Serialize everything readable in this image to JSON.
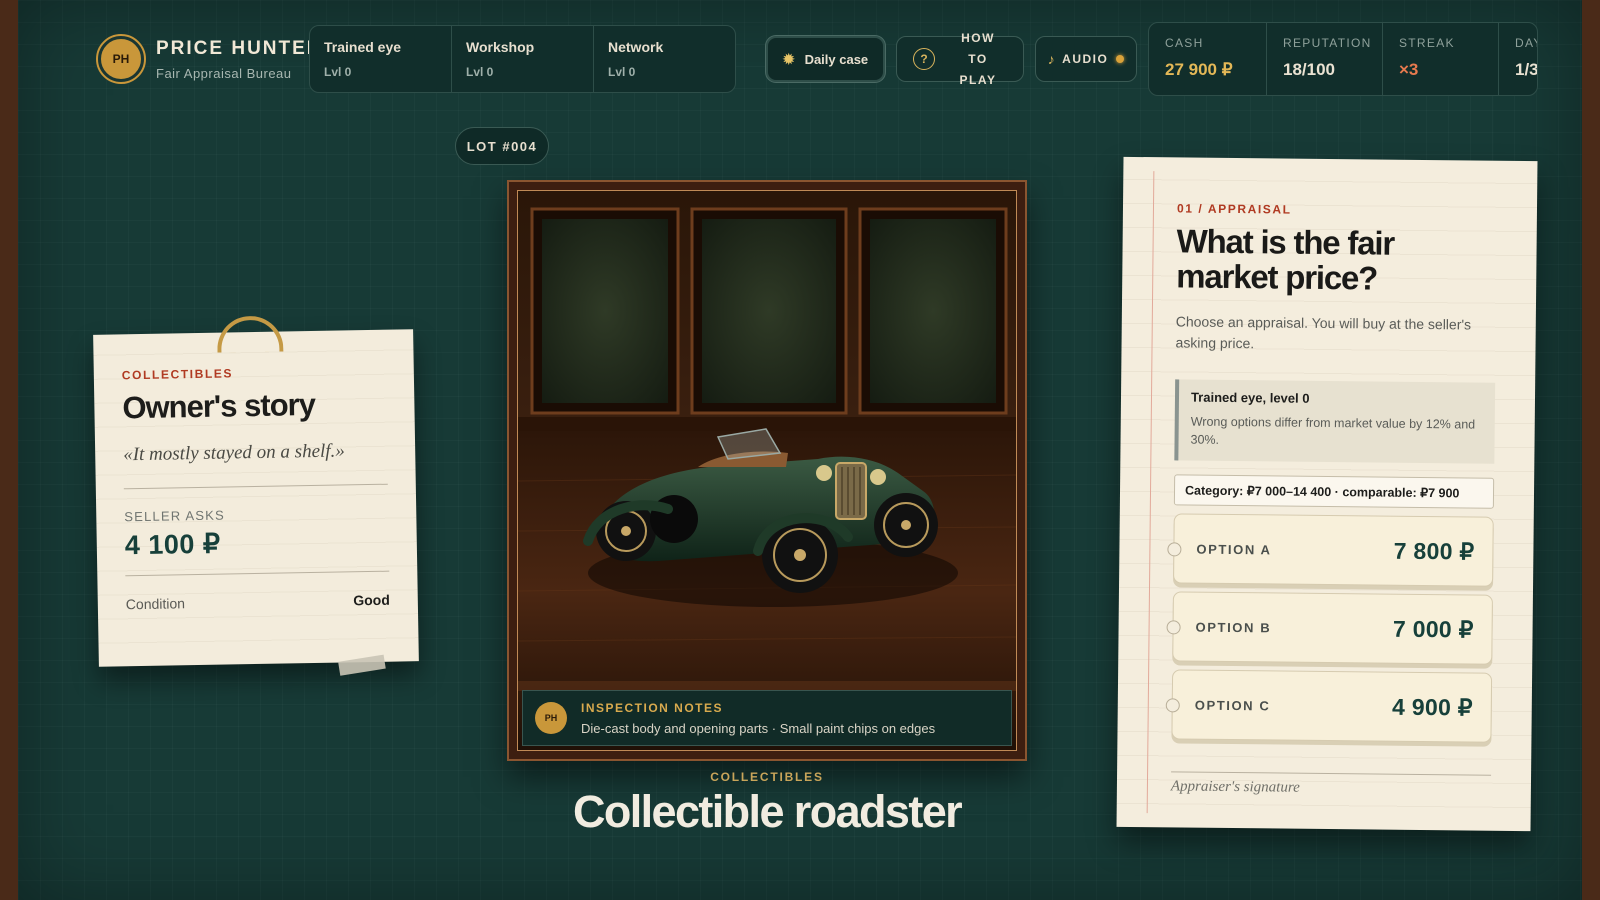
{
  "brand": {
    "logo": "PH",
    "title": "PRICE HUNTER",
    "subtitle": "Fair Appraisal Bureau"
  },
  "skills": [
    {
      "name": "Trained eye",
      "level": "Lvl 0"
    },
    {
      "name": "Workshop",
      "level": "Lvl 0"
    },
    {
      "name": "Network",
      "level": "Lvl 0"
    }
  ],
  "buttons": {
    "daily": "Daily case",
    "how_to_play": "HOW TO PLAY",
    "audio": "AUDIO",
    "icons": {
      "daily": "sun-icon",
      "how_to_play": "question-icon",
      "audio": "music-note-icon"
    }
  },
  "stats": {
    "cash": {
      "label": "CASH",
      "value": "27 900 ₽"
    },
    "reputation": {
      "label": "REPUTATION",
      "value": "18/100"
    },
    "streak": {
      "label": "STREAK",
      "value": "×3"
    },
    "day": {
      "label": "DAY",
      "value": "1/3"
    }
  },
  "owner_card": {
    "category": "COLLECTIBLES",
    "title": "Owner's story",
    "quote": "«It mostly stayed on a shelf.»",
    "seller_asks_label": "SELLER ASKS",
    "seller_asks_value": "4 100 ₽",
    "condition_label": "Condition",
    "condition_value": "Good"
  },
  "lot": {
    "tag": "LOT #004",
    "inspection_logo": "PH",
    "inspection_title": "INSPECTION NOTES",
    "inspection_text": "Die-cast body and opening parts · Small paint chips on edges",
    "category": "COLLECTIBLES",
    "title": "Collectible roadster"
  },
  "appraisal": {
    "step": "01 / APPRAISAL",
    "title": "What is the fair market price?",
    "description": "Choose an appraisal. You will buy at the seller's asking price.",
    "skill_title": "Trained eye, level 0",
    "skill_desc": "Wrong options differ from market value by 12% and 30%.",
    "category_line": "Category: ₽7 000–14 400 · comparable: ₽7 900",
    "options": [
      {
        "label": "OPTION A",
        "value": "7 800 ₽"
      },
      {
        "label": "OPTION B",
        "value": "7 000 ₽"
      },
      {
        "label": "OPTION C",
        "value": "4 900 ₽"
      }
    ],
    "signature": "Appraiser's signature"
  },
  "colors": {
    "background": "#173a36",
    "paper": "#f4eddd",
    "accent_gold": "#c9973a",
    "accent_red": "#b03a22",
    "price_green": "#17403a"
  }
}
